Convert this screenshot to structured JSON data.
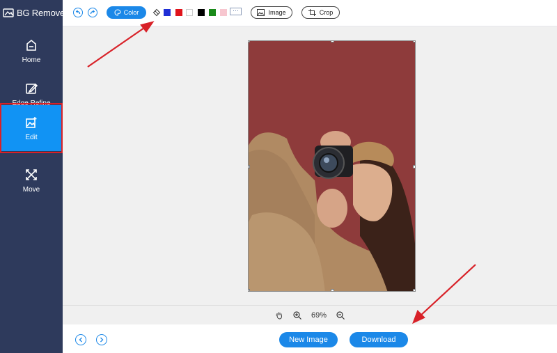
{
  "app": {
    "title": "BG Remover"
  },
  "sidebar": {
    "items": [
      {
        "label": "Home",
        "icon": "home-icon"
      },
      {
        "label": "Edge Refine",
        "icon": "edge-refine-icon"
      },
      {
        "label": "Edit",
        "icon": "edit-icon",
        "active": true
      },
      {
        "label": "Move",
        "icon": "move-icon"
      }
    ]
  },
  "toolbar": {
    "color_label": "Color",
    "swatches": [
      "#1f2fd6",
      "#e0141b",
      "#ffffff",
      "#000000",
      "#1a8a1a",
      "#f7c6cf"
    ],
    "more_label": "···",
    "image_label": "Image",
    "crop_label": "Crop"
  },
  "canvas": {
    "background_color": "#8e3b3b",
    "zoom": "69%"
  },
  "footer": {
    "new_image_label": "New Image",
    "download_label": "Download"
  },
  "colors": {
    "accent": "#1b88e8",
    "sidebar_bg": "#2e3a5c",
    "active_nav": "#1193f4",
    "annotation": "#d82128"
  }
}
